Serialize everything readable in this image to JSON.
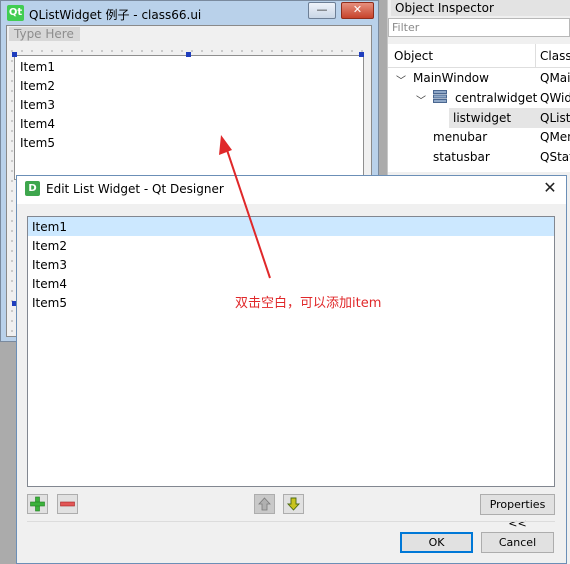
{
  "background_window": {
    "title": "QListWidget 例子 - class66.ui",
    "logo_text": "Qt",
    "minimize_glyph": "—",
    "close_glyph": "✕",
    "menubar_placeholder": "Type Here",
    "list_items": [
      "Item1",
      "Item2",
      "Item3",
      "Item4",
      "Item5"
    ]
  },
  "object_inspector": {
    "title": "Object Inspector",
    "filter_placeholder": "Filter",
    "columns": [
      "Object",
      "Class"
    ],
    "rows": [
      {
        "object": "MainWindow",
        "class": "QMai"
      },
      {
        "object": "centralwidget",
        "class": "QWid"
      },
      {
        "object": "listwidget",
        "class": "QList"
      },
      {
        "object": "menubar",
        "class": "QMen"
      },
      {
        "object": "statusbar",
        "class": "QStat"
      }
    ]
  },
  "dialog": {
    "icon_text": "D",
    "title": "Edit List Widget - Qt Designer",
    "close_glyph": "✕",
    "items": [
      "Item1",
      "Item2",
      "Item3",
      "Item4",
      "Item5"
    ],
    "selected_index": 0,
    "properties_label": "Properties <<",
    "ok_label": "OK",
    "cancel_label": "Cancel",
    "icons": {
      "add": "plus-icon",
      "remove": "minus-icon",
      "up": "arrow-up-icon",
      "down": "arrow-down-icon"
    }
  },
  "annotation": {
    "text": "双击空白，可以添加item",
    "color": "#e0282a"
  },
  "colors": {
    "selection": "#cce8ff",
    "default_button_border": "#0078d7",
    "qt_green": "#41cd52"
  }
}
